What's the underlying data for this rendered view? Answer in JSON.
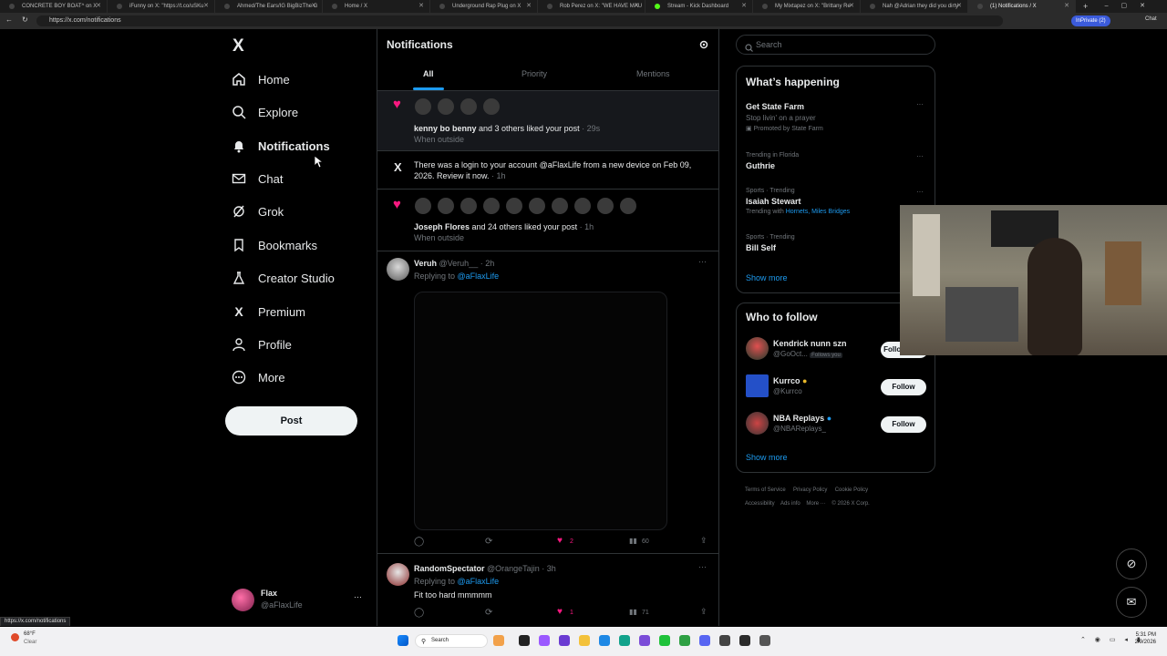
{
  "browser": {
    "tabs": [
      "CONCRETE BOY BOAT^ on X",
      "iFunny on X: \"https://t.co/uSKu",
      "Ahmed/The Ears/IG BigBizThe G",
      "Home / X",
      "Underground Rap Plug on X",
      "Rob Perez on X: \"WE HAVE MAU",
      "Stream - Kick Dashboard",
      "My Mixtapez on X: \"Brittany Re",
      "Nah @Adrian they did you dirty",
      "(1) Notifications / X"
    ],
    "url": "https://x.com/notifications",
    "inprivate": "InPrivate (2)",
    "chat": "Chat"
  },
  "sidebar": {
    "logo": "X",
    "items": [
      {
        "label": "Home",
        "icon": "home-icon"
      },
      {
        "label": "Explore",
        "icon": "search-icon"
      },
      {
        "label": "Notifications",
        "icon": "bell-icon"
      },
      {
        "label": "Chat",
        "icon": "mail-icon"
      },
      {
        "label": "Grok",
        "icon": "grok-icon"
      },
      {
        "label": "Bookmarks",
        "icon": "bookmark-icon"
      },
      {
        "label": "Creator Studio",
        "icon": "flask-icon"
      },
      {
        "label": "Premium",
        "icon": "x-icon"
      },
      {
        "label": "Profile",
        "icon": "person-icon"
      },
      {
        "label": "More",
        "icon": "more-circle-icon"
      }
    ],
    "post_button": "Post",
    "account": {
      "name": "Flax",
      "handle": "@aFlaxLife",
      "more": "···"
    }
  },
  "timeline": {
    "title": "Notifications",
    "tabs": [
      "All",
      "Priority",
      "Mentions"
    ],
    "notif1": {
      "actor": "kenny bo benny",
      "text": " and 3 others liked your post",
      "time": " · 29s",
      "sub": "When outside"
    },
    "notif2": {
      "text": "There was a login to your account @aFlaxLife from a new device on Feb 09, 2026. Review it now.",
      "time": " · 1h"
    },
    "notif3": {
      "actor": "Joseph Flores",
      "text": " and 24 others liked your post",
      "time": " · 1h",
      "sub": "When outside"
    },
    "reply1": {
      "name": "Veruh",
      "handle": "@Veruh__ · 2h",
      "replying": "Replying to ",
      "to": "@aFlaxLife",
      "likes": "2",
      "views": "60"
    },
    "reply2": {
      "name": "RandomSpectator",
      "handle": "@OrangeTajin · 3h",
      "replying": "Replying to ",
      "to": "@aFlaxLife",
      "text": "Fit too hard mmmmm",
      "likes": "1",
      "views": "71"
    }
  },
  "right": {
    "search_placeholder": "Search",
    "happening": {
      "title": "What’s happening",
      "items": [
        {
          "context": "",
          "title": "Get State Farm",
          "sub": "Stop livin' on a prayer",
          "promo": "Promoted by State Farm"
        },
        {
          "context": "Trending in Florida",
          "title": "Guthrie",
          "sub": ""
        },
        {
          "context": "Sports · Trending",
          "title": "Isaiah Stewart",
          "sub": "Trending with ",
          "links": "Hornets, Miles Bridges"
        },
        {
          "context": "Sports · Trending",
          "title": "Bill Self",
          "sub": ""
        }
      ],
      "show_more": "Show more"
    },
    "who_to_follow": {
      "title": "Who to follow",
      "people": [
        {
          "name": "Kendrick nunn szn",
          "handle": "@GoOct...",
          "badge": "Follows you",
          "button": "Follow back"
        },
        {
          "name": "Kurrco",
          "handle": "@Kurrco",
          "button": "Follow"
        },
        {
          "name": "NBA Replays",
          "handle": "@NBAReplays_",
          "button": "Follow"
        }
      ],
      "show_more": "Show more"
    },
    "footer": [
      "Terms of Service",
      "Privacy Policy",
      "Cookie Policy",
      "Accessibility",
      "Ads info",
      "More ···",
      "© 2026 X Corp."
    ]
  },
  "status_url": "https://x.com/notifications",
  "taskbar": {
    "weather_temp": "68°F",
    "weather_desc": "Clear",
    "search": "Search",
    "time": "5:31 PM",
    "date": "2/9/2026"
  },
  "colors": {
    "accent": "#1d9bf0",
    "like": "#f91880",
    "bg": "#000000"
  }
}
